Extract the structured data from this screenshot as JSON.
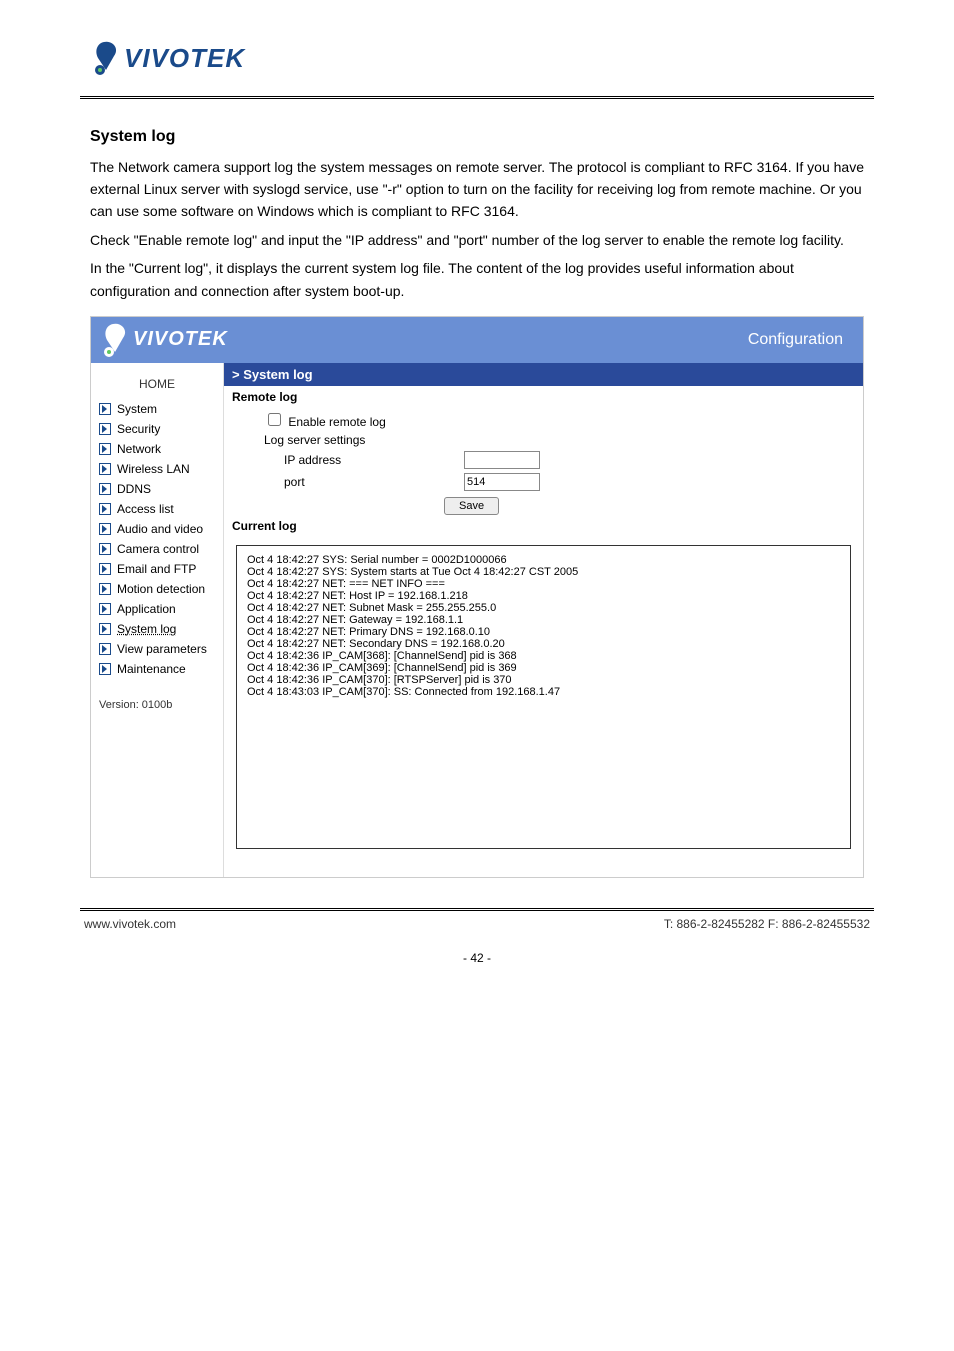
{
  "brand": "VIVOTEK",
  "header_right": "Configuration",
  "breadcrumb": "> System log",
  "page_heading": "System log",
  "paragraphs": [
    "The Network camera support log the system messages on remote server. The protocol is compliant to RFC 3164. If you have external Linux server with syslogd service, use \"-r\" option to turn on the facility for receiving log from remote machine. Or you can use some software on Windows which is compliant to RFC 3164.",
    "Check \"Enable remote log\" and input the \"IP address\" and \"port\" number of the log server to enable the remote log facility.",
    "In the \"Current log\", it displays the current system log file. The content of the log provides useful information about configuration and connection after system boot-up."
  ],
  "section_remote": "Remote log",
  "checkbox_label": "Enable remote log",
  "log_server_settings": "Log server settings",
  "ip_label": "IP address",
  "ip_value": "",
  "port_label": "port",
  "port_value": "514",
  "save_label": "Save",
  "section_current": "Current log",
  "home_label": "HOME",
  "nav": [
    {
      "label": "System"
    },
    {
      "label": "Security"
    },
    {
      "label": "Network"
    },
    {
      "label": "Wireless LAN"
    },
    {
      "label": "DDNS"
    },
    {
      "label": "Access list"
    },
    {
      "label": "Audio and video"
    },
    {
      "label": "Camera control"
    },
    {
      "label": "Email and FTP"
    },
    {
      "label": "Motion detection"
    },
    {
      "label": "Application"
    },
    {
      "label": "System log"
    },
    {
      "label": "View parameters"
    },
    {
      "label": "Maintenance"
    }
  ],
  "version": "Version: 0100b",
  "log_lines": [
    "Oct 4 18:42:27 SYS: Serial number = 0002D1000066",
    "Oct 4 18:42:27 SYS: System starts at Tue Oct 4 18:42:27 CST 2005",
    "Oct 4 18:42:27 NET: === NET INFO ===",
    "Oct 4 18:42:27 NET: Host IP = 192.168.1.218",
    "Oct 4 18:42:27 NET: Subnet Mask = 255.255.255.0",
    "Oct 4 18:42:27 NET: Gateway = 192.168.1.1",
    "Oct 4 18:42:27 NET: Primary DNS = 192.168.0.10",
    "Oct 4 18:42:27 NET: Secondary DNS = 192.168.0.20",
    "Oct 4 18:42:36 IP_CAM[368]: [ChannelSend] pid is 368",
    "Oct 4 18:42:36 IP_CAM[369]: [ChannelSend] pid is 369",
    "Oct 4 18:42:36 IP_CAM[370]: [RTSPServer] pid is 370",
    "Oct 4 18:43:03 IP_CAM[370]: SS: Connected from 192.168.1.47"
  ],
  "footer_left": "www.vivotek.com",
  "footer_right": "T: 886-2-82455282 F: 886-2-82455532",
  "footer_page": "- 42 -"
}
